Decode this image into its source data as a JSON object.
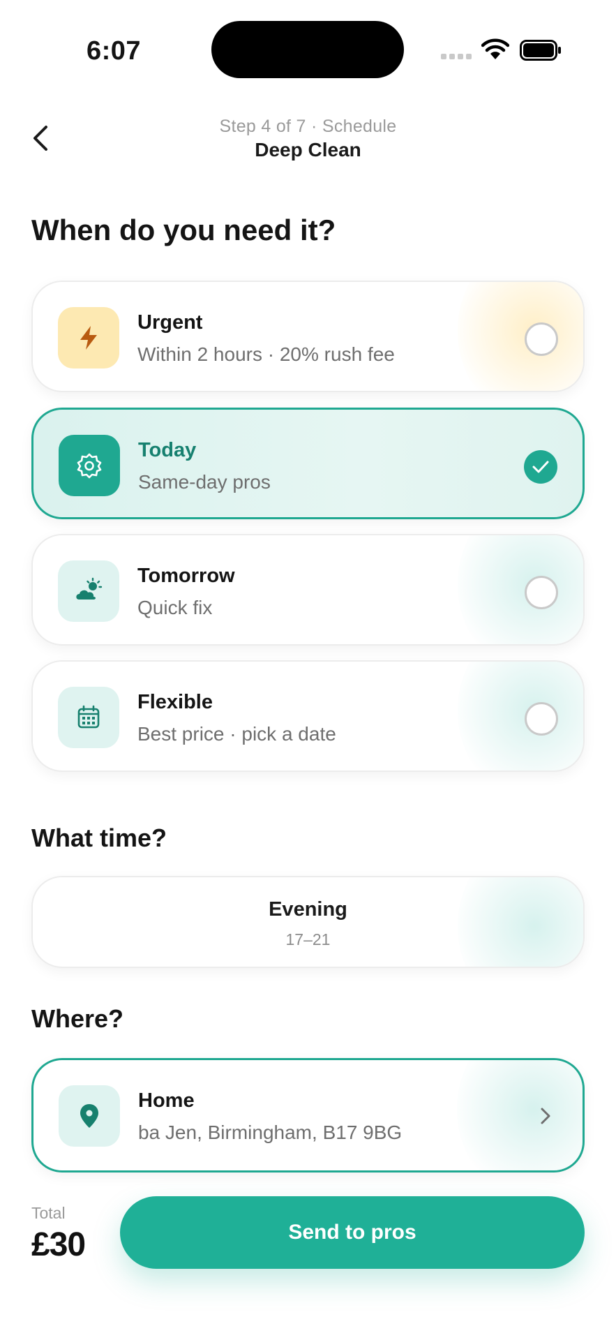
{
  "status": {
    "time": "6:07"
  },
  "header": {
    "step": "Step 4 of 7 · Schedule",
    "service": "Deep Clean"
  },
  "when": {
    "title": "When do you need it?",
    "options": [
      {
        "title": "Urgent",
        "subtitle": "Within 2 hours · 20% rush fee",
        "icon": "lightning-icon",
        "selected": false
      },
      {
        "title": "Today",
        "subtitle": "Same-day pros",
        "icon": "gear-icon",
        "selected": true
      },
      {
        "title": "Tomorrow",
        "subtitle": "Quick fix",
        "icon": "cloud-sun-icon",
        "selected": false
      },
      {
        "title": "Flexible",
        "subtitle": "Best price · pick a date",
        "icon": "calendar-icon",
        "selected": false
      }
    ]
  },
  "time_slot": {
    "title": "What time?",
    "label": "Evening",
    "range": "17–21"
  },
  "location": {
    "title": "Where?",
    "label": "Home",
    "address": "ba Jen, Birmingham, B17 9BG",
    "icon": "location-pin-icon"
  },
  "footer": {
    "total_label": "Total",
    "total_value": "£30",
    "send_label": "Send to pros"
  },
  "colors": {
    "accent": "#1fa891",
    "urgent": "#fde9b2",
    "urgent_icon": "#b85a10"
  }
}
